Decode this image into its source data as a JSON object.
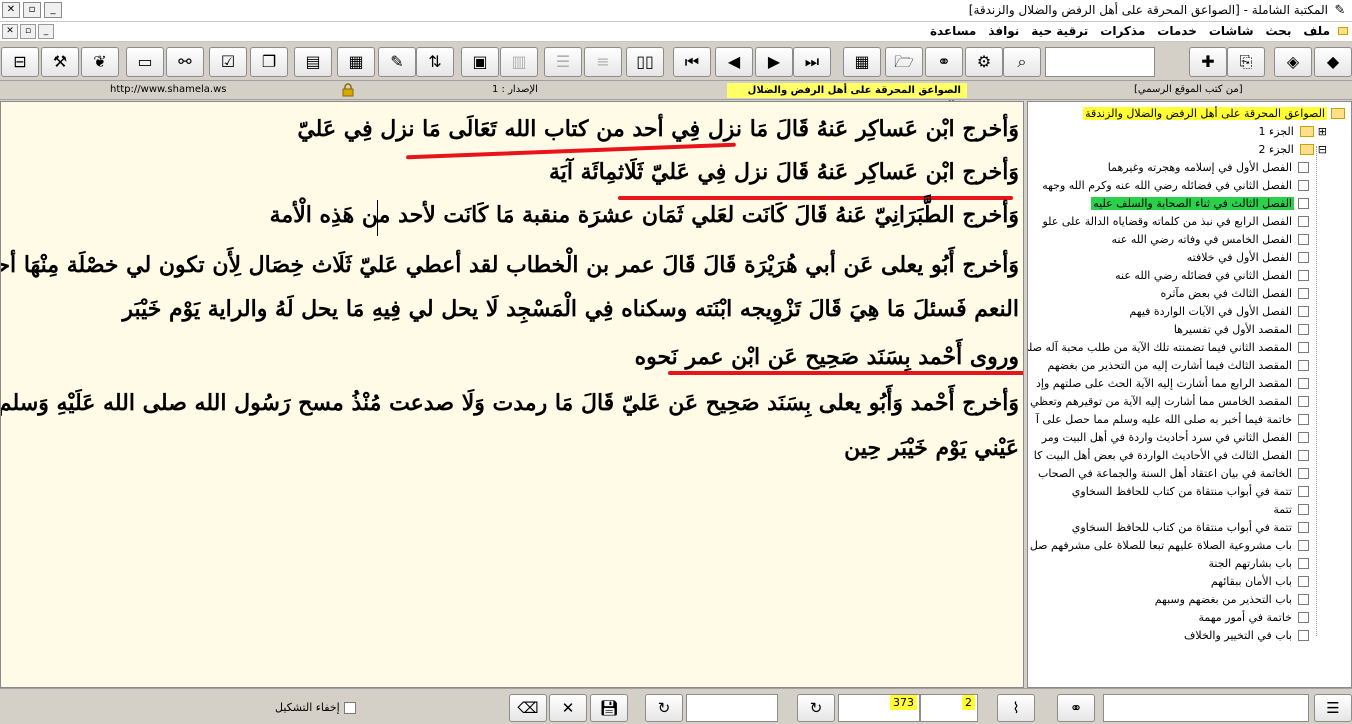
{
  "window": {
    "title": "المكتبة الشاملة - [الصواعق المحرقة على أهل الرفض والضلال والزندقة]",
    "controls": [
      "_",
      "▫",
      "✕"
    ],
    "mdi_controls": [
      "_",
      "▫",
      "✕"
    ]
  },
  "menu": [
    "ملف",
    "بحث",
    "شاشات",
    "خدمات",
    "مذكرات",
    "ترقية حية",
    "نوافذ",
    "مساعدة"
  ],
  "toolbar": {
    "buttons": [
      "book-stack-icon",
      "books-icon",
      "export-icon",
      "add-book-icon",
      "search-icon-2",
      "tools-icon",
      "binoculars-icon",
      "open-folder-icon",
      "toc-icon",
      "last-page-icon",
      "next-page-icon",
      "prev-page-icon",
      "first-page-icon",
      "open-book-icon",
      "lines-icon",
      "numbered-lines-icon",
      "stack-icon",
      "properties-icon",
      "tree-icon",
      "pen-icon",
      "note-icon",
      "page-icon",
      "copy-icon",
      "check-icon",
      "link-icon",
      "new-page-icon",
      "leaf-icon",
      "hammer-icon",
      "usb-icon"
    ]
  },
  "infobar": {
    "url": "http://www.shamela.ws",
    "version": "الإصدار : 1",
    "book_label": "الصواعق المحرقة على أهل الرفض والضلال والزندقة",
    "source": "[من كتب الموقع الرسمي]"
  },
  "content": {
    "paragraphs": [
      "وَأخرج ابْن عَساكِر عَنهُ قَالَ مَا نزل فِي أحد من كتاب الله تَعَالَى مَا نزل فِي عَليّ",
      "وَأخرج ابْن عَساكِر عَنهُ قَالَ نزل فِي عَليّ ثَلَاثمِائَة آيَة",
      "وَأخرج الطَّبَرَانِيّ عَنهُ قَالَ كَانَت لعَلي ثَمَان عشرَة منقبة مَا كَانَت لأحد من هَذِه الْأمة",
      "وَأخرج أَبُو يعلى عَن أبي هُرَيْرَة قَالَ قَالَ عمر بن الْخطاب لقد أعطي عَليّ ثَلَاث خِصَال لِأَن تكون لي خصْلَة مِنْهَا أحب إِلَيّ من حمر",
      "النعم فَسئلَ مَا هِيَ قَالَ تَزْوِيجه ابْنَته وسكناه فِي الْمَسْجِد لَا يحل لي فِيهِ مَا يحل لَهُ والراية يَوْم خَيْبَر",
      "وروى أَحْمد بِسَنَد صَحِيح عَن ابْن عمر نَحوه",
      "وَأخرج أَحْمد وَأَبُو يعلى بِسَنَد صَحِيح عَن عَليّ قَالَ مَا رمدت وَلَا صدعت مُنْذُ مسح رَسُول الله صلى الله عَلَيْهِ وَسلم وَجْهي وتفل فِي",
      "عَيْني يَوْم خَيْبَر حِين"
    ]
  },
  "tree": {
    "root": "الصواعق المحرقة على أهل الرفض والضلال والزندقة",
    "parts": [
      "الجزء 1",
      "الجزء 2"
    ],
    "chapters": [
      "الفصل الأول في إسلامه وهجرته وغيرهما",
      "الفصل الثاني في فضائله رضي الله عنه وكرم الله وجهه",
      "الفصل الثالث في ثناء الصحابة والسلف عليه",
      "الفصل الرابع في نبذ من كلماته وقضاياه الدالة على علو",
      "الفصل الخامس في وفاته رضي الله عنه",
      "الفصل الأول في خلافته",
      "الفصل الثاني في فضائله رضي الله عنه",
      "الفصل الثالث في بعض مآثره",
      "الفصل الأول في الآيات الواردة فيهم",
      "المقصد الأول في تفسيرها",
      "المقصد الثاني فيما تضمنته تلك الآية من طلب محبة آله صلى",
      "المقصد الثالث فيما أشارت إليه من التحذير من بغضهم",
      "المقصد الرابع مما أشارت إليه الآية الحث على صلتهم وإد",
      "المقصد الخامس مما أشارت إليه الآية من توقيرهم وتعظي",
      "خاتمة فيما أخبر به صلى الله عليه وسلم مما حصل على آ",
      "الفصل الثاني في سرد أحاديث واردة في أهل البيت ومر",
      "الفصل الثالث في الأحاديث الواردة في بعض أهل البيت كا",
      "الخاتمة في بيان اعتقاد أهل السنة والجماعة في الصحاب",
      "تتمة في أبواب منتقاة من كتاب للحافظ السخاوي",
      "تتمة",
      "تتمة في أبواب منتقاة من كتاب للحافظ السخاوي",
      "باب مشروعية الصلاة عليهم تبعا للصلاة على مشرفهم صل",
      "باب بشارتهم الجنة",
      "باب الأمان ببقائهم",
      "باب التحذير من بغضهم وسبهم",
      "خاتمة في أمور مهمة",
      "باب في التخيير والخلاف"
    ],
    "selected_index": 2
  },
  "bottombar": {
    "page": "373",
    "part": "2",
    "hide_tashkeel": "إخفاء التشكيل"
  },
  "colors": {
    "highlight": "#ffff33",
    "selected": "#2bd14b",
    "underline": "#e8131b",
    "page_bg": "#fffbe6"
  }
}
